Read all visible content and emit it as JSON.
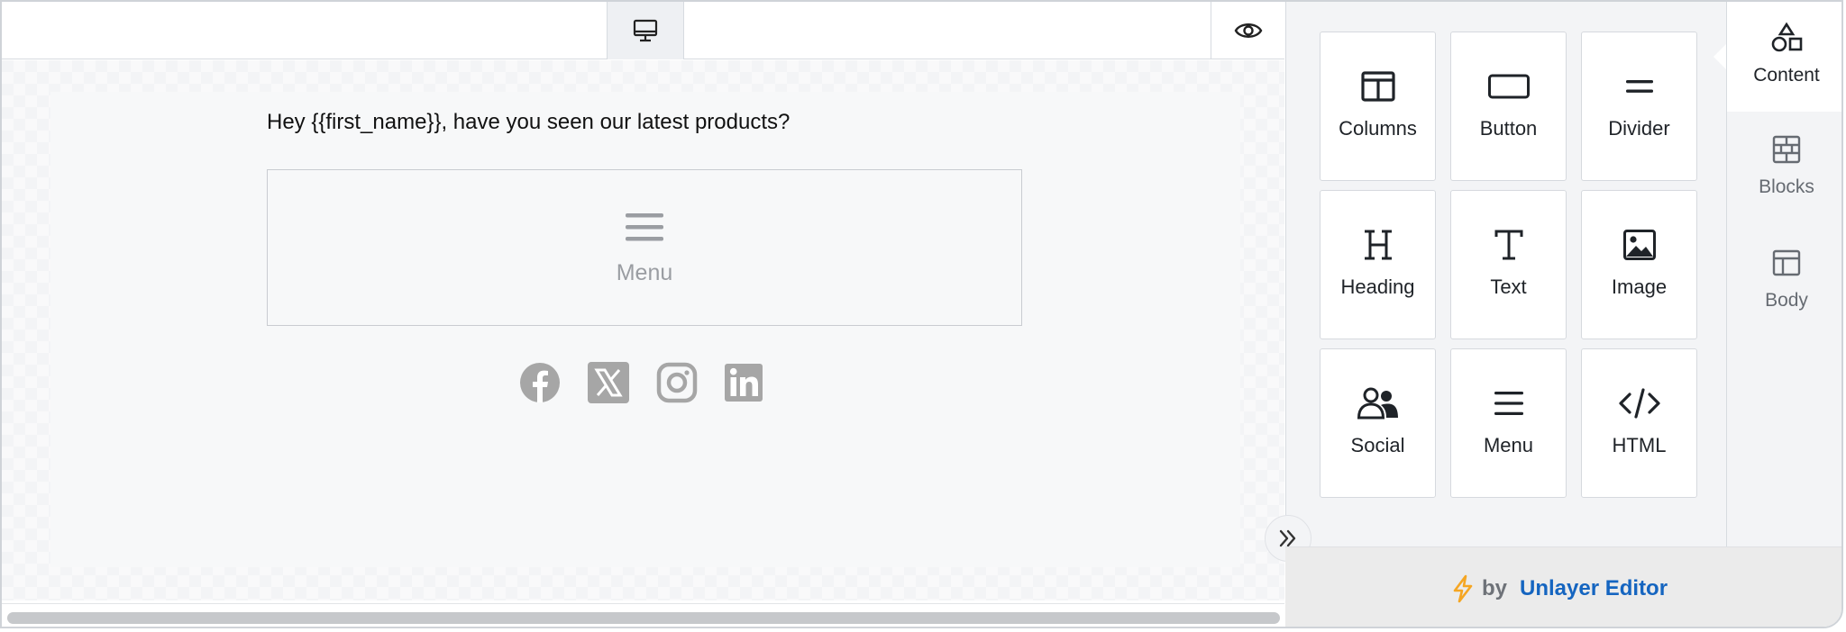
{
  "toolbar": {
    "device_icon": "desktop-icon",
    "preview_icon": "eye-icon"
  },
  "email": {
    "headline": "Hey {{first_name}}, have you seen our latest products?",
    "menu_block_label": "Menu",
    "social_icons": [
      "facebook-icon",
      "x-icon",
      "instagram-icon",
      "linkedin-icon"
    ]
  },
  "tools": [
    {
      "label": "Columns",
      "icon": "columns-icon"
    },
    {
      "label": "Button",
      "icon": "button-icon"
    },
    {
      "label": "Divider",
      "icon": "divider-icon"
    },
    {
      "label": "Heading",
      "icon": "heading-icon"
    },
    {
      "label": "Text",
      "icon": "text-icon"
    },
    {
      "label": "Image",
      "icon": "image-icon"
    },
    {
      "label": "Social",
      "icon": "social-icon"
    },
    {
      "label": "Menu",
      "icon": "menu-icon"
    },
    {
      "label": "HTML",
      "icon": "code-icon"
    }
  ],
  "tabs": [
    {
      "label": "Content",
      "icon": "shapes-icon",
      "active": true
    },
    {
      "label": "Blocks",
      "icon": "blocks-icon",
      "active": false
    },
    {
      "label": "Body",
      "icon": "layout-icon",
      "active": false
    }
  ],
  "footer": {
    "by": "by",
    "brand": "Unlayer Editor",
    "icon": "lightning-icon"
  },
  "colors": {
    "brand": "#1565c0",
    "lightning": "#f5a623",
    "social_gray": "#a6a6a6"
  }
}
